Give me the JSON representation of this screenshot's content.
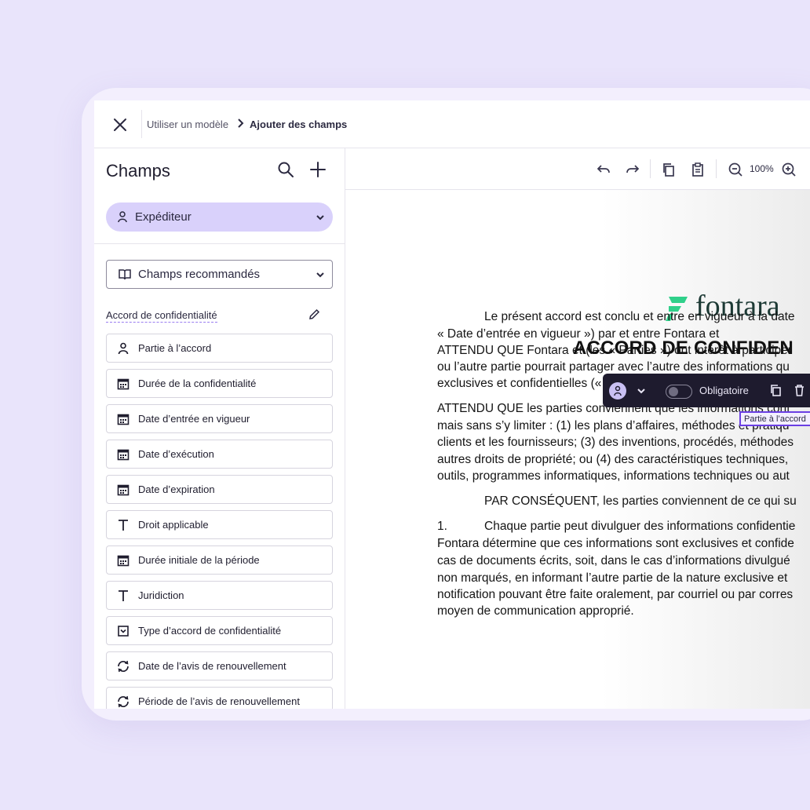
{
  "breadcrumb": {
    "step1": "Utiliser un modèle",
    "step2": "Ajouter des champs"
  },
  "sidebar": {
    "title": "Champs",
    "sender": "Expéditeur",
    "recommended": "Champs recommandés",
    "section_label": "Accord de confidentialité",
    "fields": [
      {
        "label": "Partie à l’accord",
        "icon": "person-icon"
      },
      {
        "label": "Durée de la confidentialité",
        "icon": "calendar-icon"
      },
      {
        "label": "Date d’entrée en vigueur",
        "icon": "calendar-icon"
      },
      {
        "label": "Date d’exécution",
        "icon": "calendar-icon"
      },
      {
        "label": "Date d’expiration",
        "icon": "calendar-icon"
      },
      {
        "label": "Droit applicable",
        "icon": "text-icon"
      },
      {
        "label": "Durée initiale de la période",
        "icon": "calendar-icon"
      },
      {
        "label": "Juridiction",
        "icon": "text-icon"
      },
      {
        "label": "Type d’accord de confidentialité",
        "icon": "dropdown-icon"
      },
      {
        "label": "Date de l’avis de renouvellement",
        "icon": "renew-icon"
      },
      {
        "label": "Période de l’avis de renouvellement",
        "icon": "renew-icon"
      }
    ]
  },
  "toolbar": {
    "zoom": "100%"
  },
  "document": {
    "brand": "fontara",
    "title": "ACCORD DE CONFIDEN",
    "lines": [
      "Le présent accord est conclu et entre en vigueur à la date",
      "« Date d’entrée en vigueur ») par et entre Fontara et",
      "ATTENDU QUE Fontara et (les « Parties ») ont intérêt à participer",
      "ou l’autre partie pourrait partager avec l’autre des informations qu",
      "exclusives et confidentielles (« Informations confidentielles »); et",
      "ATTENDU QUE les parties conviennent que les informations conf",
      "mais sans s’y limiter : (1) les plans d’affaires, méthodes et pratiqu",
      "clients et les fournisseurs; (3) des inventions, procédés, méthodes",
      "autres droits de propriété; ou (4) des caractéristiques techniques,",
      "outils, programmes informatiques, informations techniques ou aut",
      "PAR CONSÉQUENT, les parties conviennent de ce qui su",
      "1.",
      "Chaque partie peut divulguer des informations confidentie",
      "Fontara détermine que ces informations sont exclusives et confide",
      "cas de documents écrits, soit, dans le cas d’informations divulgué",
      "non marqués, en informant l’autre partie de la nature exclusive et",
      "notification pouvant être faite oralement, par courriel ou par corres",
      "moyen de communication approprié."
    ]
  },
  "field_toolbar": {
    "required_label": "Obligatoire",
    "placed_field": "Partie à l’accord"
  },
  "colors": {
    "background": "#e9e4fb",
    "sender_pill": "#d9d1fb",
    "accent": "#6a3fe3",
    "brand_green": "#2fd08a"
  }
}
